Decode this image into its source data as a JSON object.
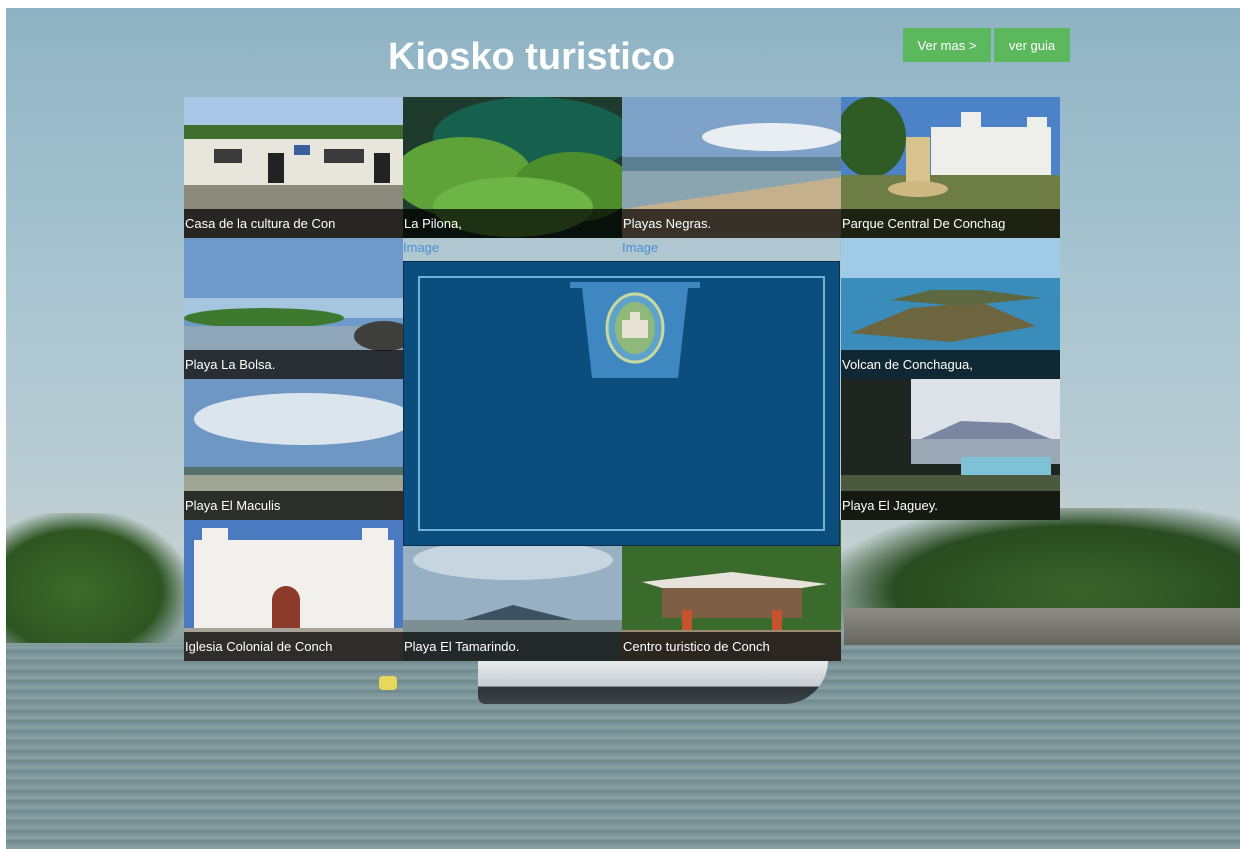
{
  "header": {
    "title": "Kiosko turistico",
    "buttons": {
      "more": "Ver mas >",
      "guide": "ver guia"
    },
    "accent": "#5cb85c"
  },
  "grid": {
    "tiles": [
      {
        "caption": "Casa de la cultura de Con",
        "photo": "building"
      },
      {
        "caption": "La Pilona,",
        "photo": "foliage"
      },
      {
        "caption": "Playas Negras.",
        "photo": "beach"
      },
      {
        "caption": "Parque Central De Conchag",
        "photo": "church-park"
      },
      {
        "caption": "Playa La Bolsa.",
        "photo": "coast"
      },
      {
        "caption": "Volcan de Conchagua,",
        "photo": "island"
      },
      {
        "caption": "Playa El Maculis",
        "photo": "sky-beach"
      },
      {
        "caption": "Playa El Jaguey.",
        "photo": "palms-pool"
      },
      {
        "caption": "Iglesia Colonial de Conch",
        "photo": "church"
      },
      {
        "caption": "Playa El Tamarindo.",
        "photo": "sea-mountain"
      },
      {
        "caption": "Centro turistico de Conch",
        "photo": "pavilion"
      }
    ],
    "image_links": [
      "Image",
      "Image"
    ]
  },
  "center_panel": {
    "background": "#0b4d7d",
    "border": "#6fb3d9",
    "emblem": "shield-emblem-icon"
  }
}
